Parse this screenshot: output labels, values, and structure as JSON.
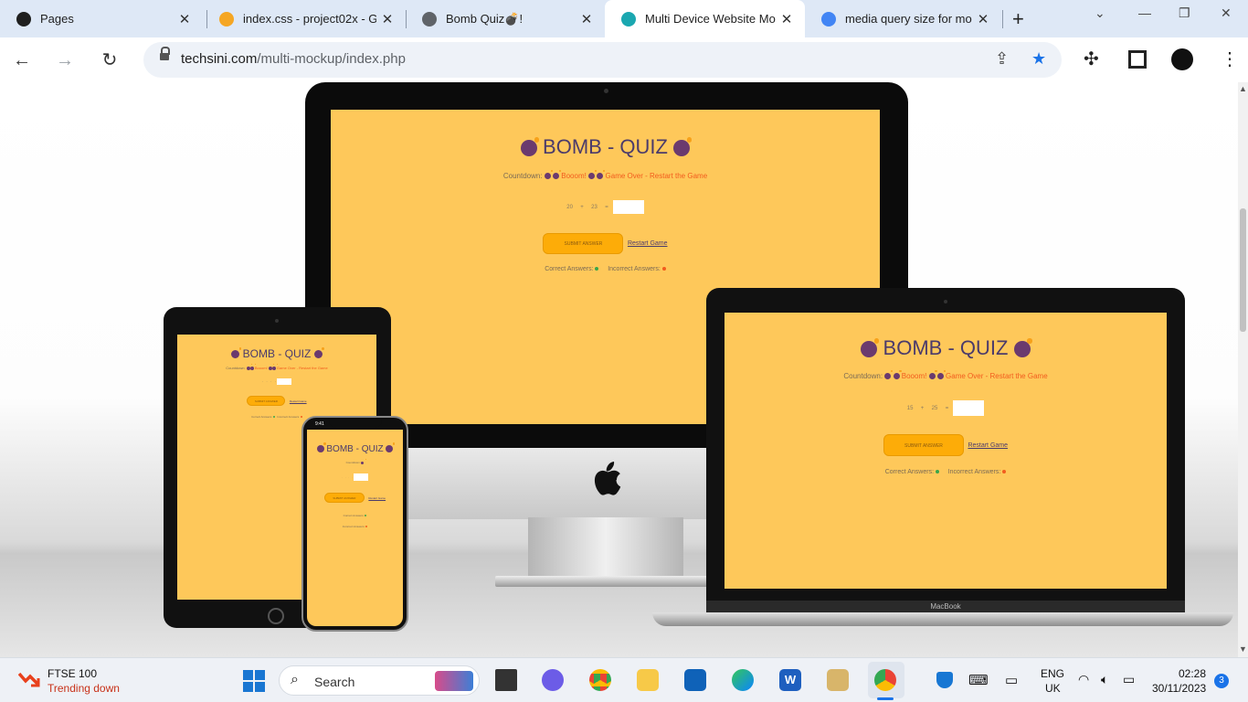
{
  "browser": {
    "tabs": [
      {
        "title": "Pages",
        "icon": "github-icon",
        "color": "#1f1f1f"
      },
      {
        "title": "index.css - project02x - G",
        "icon": "gitpod-icon",
        "color": "#f5a623"
      },
      {
        "title": "Bomb Quiz💣!",
        "icon": "globe-icon",
        "color": "#5f6368"
      },
      {
        "title": "Multi Device Website Mo",
        "icon": "techsini-icon",
        "color": "#1aa7b0"
      },
      {
        "title": "media query size for mob",
        "icon": "google-icon",
        "color": "#4285f4"
      }
    ],
    "active_tab": 3,
    "url_host": "techsini.com",
    "url_path": "/multi-mockup/index.php"
  },
  "quiz": {
    "title": "BOMB - QUIZ",
    "countdown_label": "Countdown:",
    "boom_text": "Booom!",
    "game_over_text": "Game Over - Restart the Game",
    "imac_q": {
      "a": "20",
      "op": "+",
      "b": "23",
      "eq": "="
    },
    "macbook_q": {
      "a": "15",
      "op": "+",
      "b": "25",
      "eq": "="
    },
    "submit_label": "SUBMIT ANSWER",
    "restart_label": "Restart Game",
    "correct_label": "Correct Answers:",
    "incorrect_label": "Incorrect Answers:",
    "correct_color": "#3aa64a",
    "incorrect_color": "#f25c1e",
    "phone_time": "9:41"
  },
  "device_labels": {
    "macbook": "MacBook"
  },
  "taskbar": {
    "widget_title": "FTSE 100",
    "widget_sub": "Trending down",
    "search_placeholder": "Search",
    "lang": "ENG",
    "region": "UK",
    "time": "02:28",
    "date": "30/11/2023",
    "notif_count": "3"
  }
}
